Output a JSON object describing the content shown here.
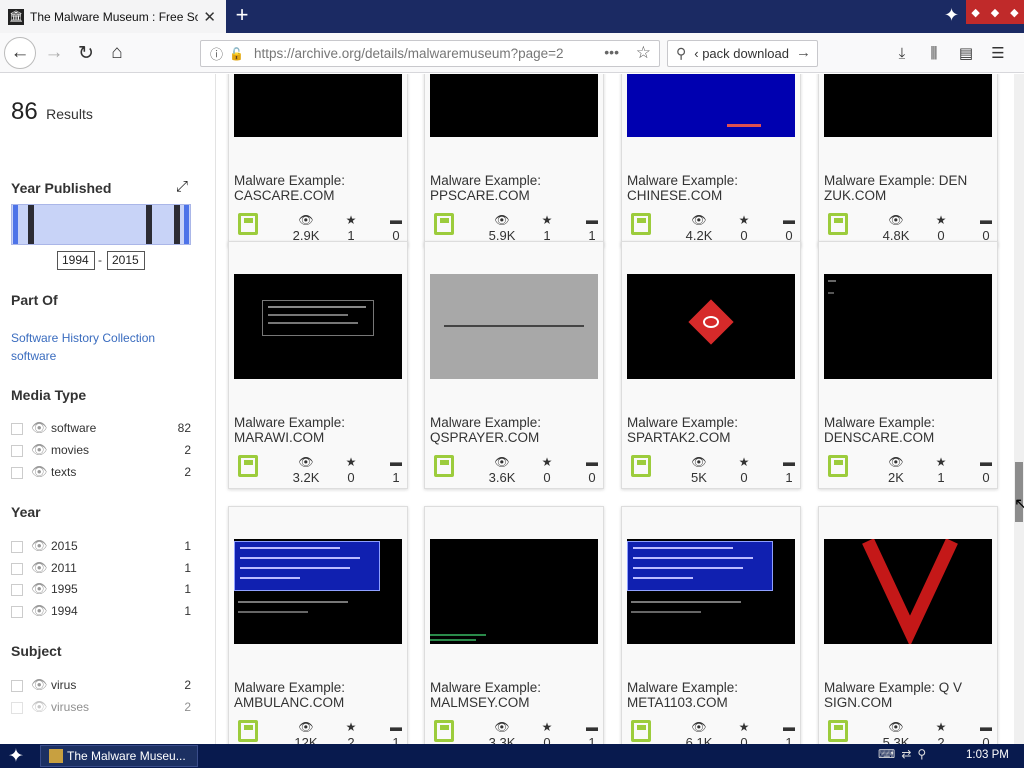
{
  "browser": {
    "tab_title": "The Malware Museum : Free Softw",
    "tab_close": "✕",
    "new_tab": "+",
    "url": "https://archive.org/details/malwaremuseum?page=2",
    "search_value": "‹ pack download"
  },
  "sidebar": {
    "results_count": "86",
    "results_label": "Results",
    "year_published_title": "Year Published",
    "year_range": {
      "from": "1994",
      "to": "2015",
      "separator": "-"
    },
    "part_of_title": "Part Of",
    "part_of_links": [
      "Software History Collection",
      "software"
    ],
    "media_type_title": "Media Type",
    "media_types": [
      {
        "label": "software",
        "count": "82"
      },
      {
        "label": "movies",
        "count": "2"
      },
      {
        "label": "texts",
        "count": "2"
      }
    ],
    "year_title": "Year",
    "years": [
      {
        "label": "2015",
        "count": "1"
      },
      {
        "label": "2011",
        "count": "1"
      },
      {
        "label": "1995",
        "count": "1"
      },
      {
        "label": "1994",
        "count": "1"
      }
    ],
    "subject_title": "Subject",
    "subjects": [
      {
        "label": "virus",
        "count": "2"
      },
      {
        "label": "viruses",
        "count": "2"
      }
    ]
  },
  "items": [
    {
      "title": "Malware Example: CASCARE.COM",
      "views": "2.9K",
      "favorites": "1",
      "reviews": "0",
      "thumb": "dos-text"
    },
    {
      "title": "Malware Example: PPSCARE.COM",
      "views": "5.9K",
      "favorites": "1",
      "reviews": "1",
      "thumb": "dos-text"
    },
    {
      "title": "Malware Example: CHINESE.COM",
      "views": "4.2K",
      "favorites": "0",
      "reviews": "0",
      "thumb": "blue-screen"
    },
    {
      "title": "Malware Example: DEN ZUK.COM",
      "views": "4.8K",
      "favorites": "0",
      "reviews": "0",
      "thumb": "black"
    },
    {
      "title": "Malware Example: MARAWI.COM",
      "views": "3.2K",
      "favorites": "0",
      "reviews": "1",
      "thumb": "dos-box"
    },
    {
      "title": "Malware Example: QSPRAYER.COM",
      "views": "3.6K",
      "favorites": "0",
      "reviews": "0",
      "thumb": "grey"
    },
    {
      "title": "Malware Example: SPARTAK2.COM",
      "views": "5K",
      "favorites": "0",
      "reviews": "1",
      "thumb": "red-diamond"
    },
    {
      "title": "Malware Example: DENSCARE.COM",
      "views": "2K",
      "favorites": "1",
      "reviews": "0",
      "thumb": "black-dots"
    },
    {
      "title": "Malware Example: AMBULANC.COM",
      "views": "12K",
      "favorites": "2",
      "reviews": "1",
      "thumb": "dosbox-blue"
    },
    {
      "title": "Malware Example: MALMSEY.COM",
      "views": "3.3K",
      "favorites": "0",
      "reviews": "1",
      "thumb": "black-green"
    },
    {
      "title": "Malware Example: META1103.COM",
      "views": "6.1K",
      "favorites": "0",
      "reviews": "1",
      "thumb": "dosbox-blue"
    },
    {
      "title": "Malware Example: Q V SIGN.COM",
      "views": "5.3K",
      "favorites": "2",
      "reviews": "0",
      "thumb": "red-v"
    }
  ],
  "taskbar": {
    "window_title": "The Malware Museu...",
    "clock": "1:03 PM"
  }
}
